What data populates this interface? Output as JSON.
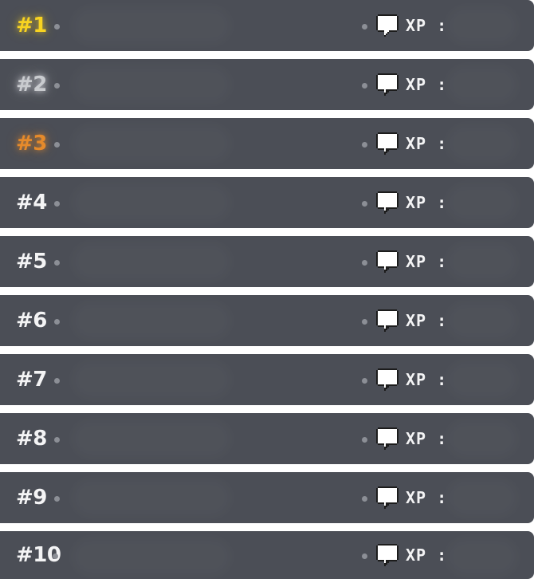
{
  "leaderboard": {
    "rows": [
      {
        "rank": "#1",
        "xp_label": "XP :",
        "tier": "gold"
      },
      {
        "rank": "#2",
        "xp_label": "XP :",
        "tier": "silver"
      },
      {
        "rank": "#3",
        "xp_label": "XP :",
        "tier": "bronze"
      },
      {
        "rank": "#4",
        "xp_label": "XP :",
        "tier": "normal"
      },
      {
        "rank": "#5",
        "xp_label": "XP :",
        "tier": "normal"
      },
      {
        "rank": "#6",
        "xp_label": "XP :",
        "tier": "normal"
      },
      {
        "rank": "#7",
        "xp_label": "XP :",
        "tier": "normal"
      },
      {
        "rank": "#8",
        "xp_label": "XP :",
        "tier": "normal"
      },
      {
        "rank": "#9",
        "xp_label": "XP :",
        "tier": "normal"
      },
      {
        "rank": "#10",
        "xp_label": "XP :",
        "tier": "normal"
      }
    ]
  },
  "icons": {
    "message": "chat-bubble-icon"
  },
  "colors": {
    "row_background": "#4b4e56",
    "gold": "#f8d321",
    "silver": "#c9cbcf",
    "bronze": "#e58a2b",
    "text": "#f4f4f5"
  }
}
